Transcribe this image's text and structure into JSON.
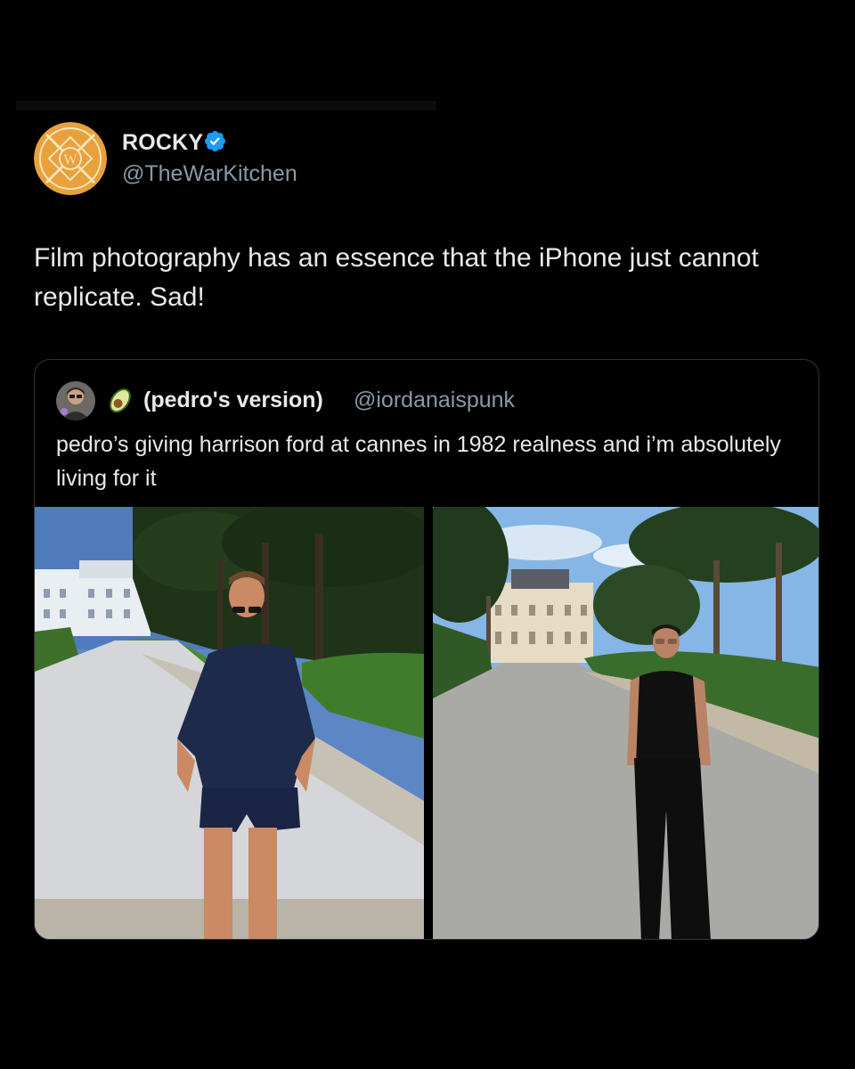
{
  "author": {
    "display_name": "ROCKY",
    "handle": "@TheWarKitchen",
    "verified": true,
    "avatar_icon": "war-kitchen-logo-icon",
    "avatar_color": "#e8a13c"
  },
  "tweet": {
    "text": "Film photography has an essence that the iPhone just cannot replicate. Sad!"
  },
  "quote": {
    "avatar_icon": "user-avatar-icon",
    "emoji_icon": "avocado-icon",
    "display_name": "(pedro's version)",
    "handle": "@iordanaispunk",
    "text": "pedro’s giving harrison ford at cannes in 1982 realness and i’m absolutely living for it",
    "media": [
      {
        "description_icon": "photo-harrison-ford-icon"
      },
      {
        "description_icon": "photo-pedro-pascal-icon"
      }
    ]
  },
  "colors": {
    "background": "#000000",
    "text_primary": "#e7e9ea",
    "text_secondary": "#8b98a5",
    "verified_blue": "#1d9bf0",
    "border": "#2f3336"
  }
}
